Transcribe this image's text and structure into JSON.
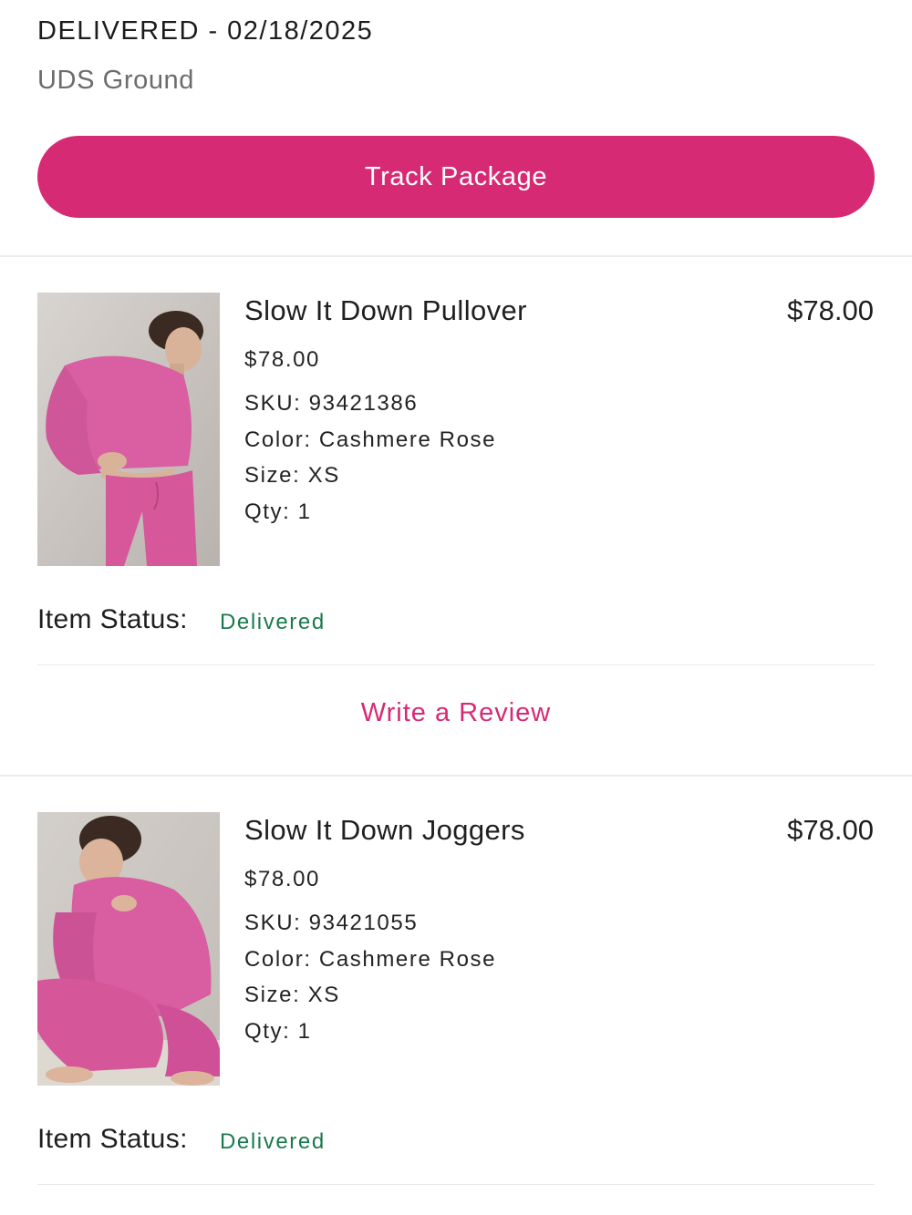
{
  "colors": {
    "accent": "#d62a74",
    "status_ok": "#1a7a4d",
    "text": "#1f1f1f",
    "muted": "#6c6c6c"
  },
  "shipment": {
    "status": "DELIVERED - 02/18/2025",
    "carrier": "UDS Ground",
    "track_label": "Track Package"
  },
  "items": [
    {
      "name": "Slow It Down Pullover",
      "total": "$78.00",
      "price": "$78.00",
      "sku": "SKU: 93421386",
      "color": "Color: Cashmere Rose",
      "size": "Size: XS",
      "qty": "Qty: 1",
      "status_label": "Item Status:",
      "status_value": "Delivered",
      "review_label": "Write a Review",
      "image": "product-photo-pullover"
    },
    {
      "name": "Slow It Down Joggers",
      "total": "$78.00",
      "price": "$78.00",
      "sku": "SKU: 93421055",
      "color": "Color: Cashmere Rose",
      "size": "Size: XS",
      "qty": "Qty: 1",
      "status_label": "Item Status:",
      "status_value": "Delivered",
      "image": "product-photo-joggers"
    }
  ]
}
